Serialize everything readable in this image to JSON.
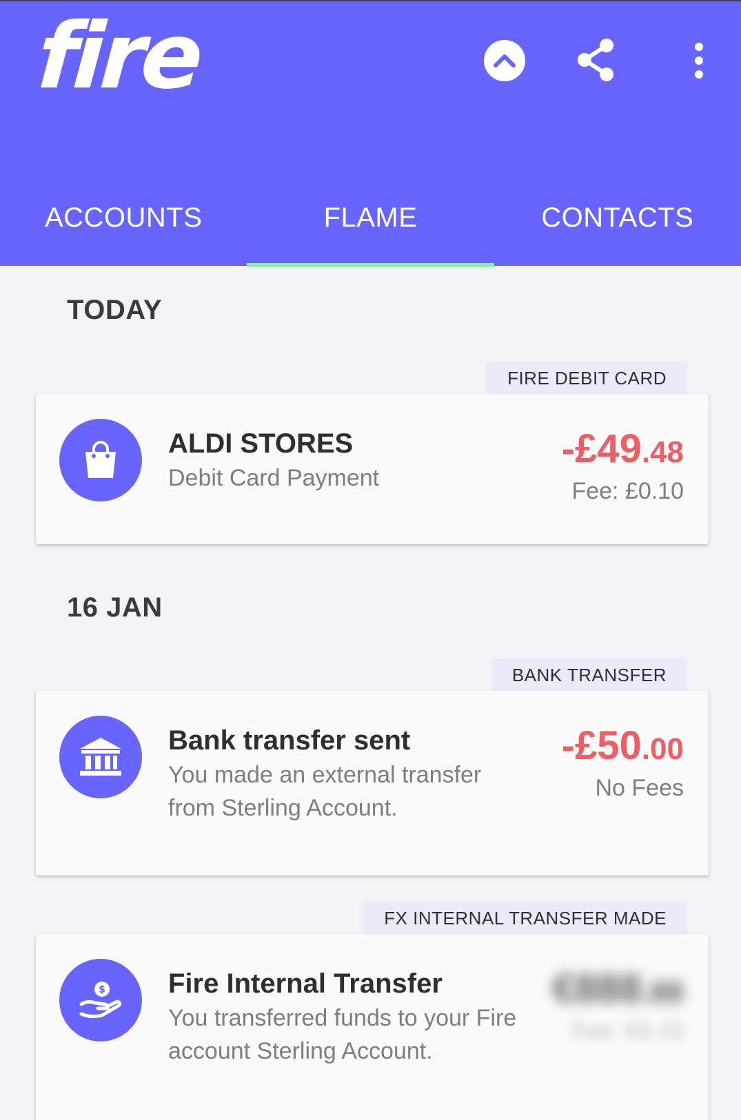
{
  "header": {
    "logo_text": "fire",
    "logo_tm": "™",
    "background_color": "#6764ff",
    "icons": [
      "chevron-up-icon",
      "share-icon",
      "more-vertical-icon"
    ]
  },
  "tabs": [
    {
      "label": "ACCOUNTS",
      "active": false
    },
    {
      "label": "FLAME",
      "active": true
    },
    {
      "label": "CONTACTS",
      "active": false
    }
  ],
  "tab_indicator_color": "#8ff0a8",
  "sections": [
    {
      "date": "TODAY",
      "transactions": [
        {
          "category": "FIRE DEBIT CARD",
          "icon": "shopping-bag-icon",
          "title": "ALDI STORES",
          "subtitle": "Debit Card Payment",
          "amount_main": "-£49",
          "amount_minor": ".48",
          "fee": "Fee: £0.10"
        }
      ]
    },
    {
      "date": "16 JAN",
      "transactions": [
        {
          "category": "BANK TRANSFER",
          "icon": "bank-icon",
          "title": "Bank transfer sent",
          "subtitle": "You made an external transfer from Sterling Account.",
          "amount_main": "-£50",
          "amount_minor": ".00",
          "fee": "No Fees"
        },
        {
          "category": "FX INTERNAL TRANSFER MADE",
          "icon": "hand-coin-icon",
          "title": "Fire Internal Transfer",
          "subtitle": "You transferred funds to your Fire account Sterling Account.",
          "amount_main": "€888",
          "amount_minor": ".88",
          "fee": "Fee: €0.15",
          "amount_blurred": true
        }
      ]
    }
  ],
  "colors": {
    "accent": "#6764ff",
    "debit_amount": "#ec5f64",
    "page_background": "#f3f3f6",
    "chip_background": "#eceaf9"
  }
}
